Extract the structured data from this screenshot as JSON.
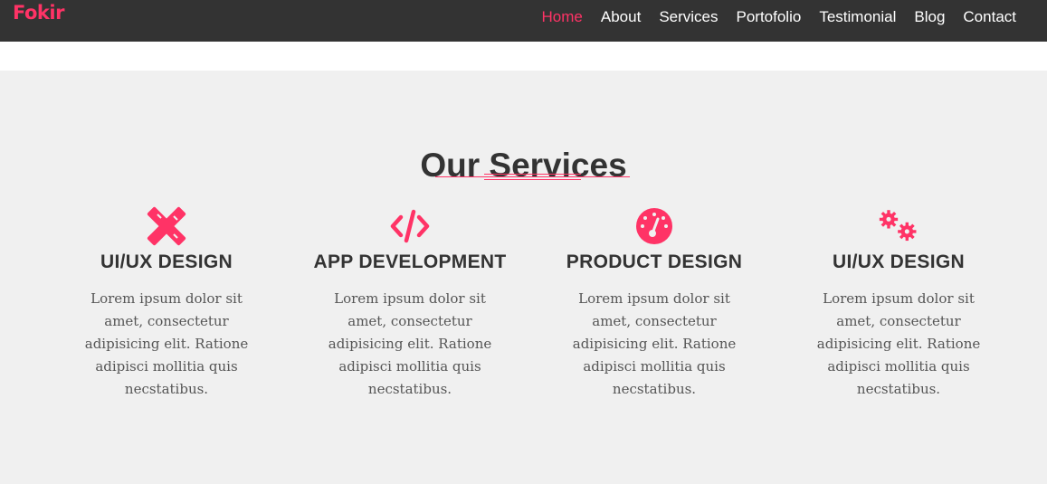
{
  "colors": {
    "accent": "#ff3366",
    "navbar_bg": "#333333",
    "section_bg": "#f0f0f0"
  },
  "header": {
    "brand": "Fokir",
    "nav": [
      {
        "label": "Home",
        "active": true
      },
      {
        "label": "About",
        "active": false
      },
      {
        "label": "Services",
        "active": false
      },
      {
        "label": "Portofolio",
        "active": false
      },
      {
        "label": "Testimonial",
        "active": false
      },
      {
        "label": "Blog",
        "active": false
      },
      {
        "label": "Contact",
        "active": false
      }
    ]
  },
  "services": {
    "title": "Our Services",
    "items": [
      {
        "icon": "pencil-ruler-icon",
        "title": "UI/UX DESIGN",
        "text": "Lorem ipsum dolor sit amet, consectetur adipisicing elit. Ratione adipisci mollitia quis necstatibus."
      },
      {
        "icon": "code-icon",
        "title": "APP DEVELOPMENT",
        "text": "Lorem ipsum dolor sit amet, consectetur adipisicing elit. Ratione adipisci mollitia quis necstatibus."
      },
      {
        "icon": "tachometer-icon",
        "title": "PRODUCT DESIGN",
        "text": "Lorem ipsum dolor sit amet, consectetur adipisicing elit. Ratione adipisci mollitia quis necstatibus."
      },
      {
        "icon": "gears-icon",
        "title": "UI/UX DESIGN",
        "text": "Lorem ipsum dolor sit amet, consectetur adipisicing elit. Ratione adipisci mollitia quis necstatibus."
      }
    ]
  }
}
